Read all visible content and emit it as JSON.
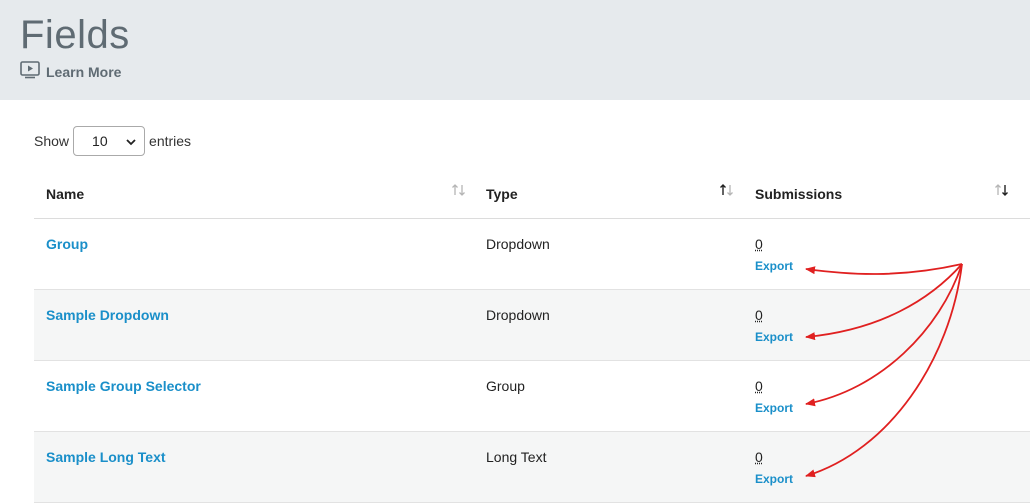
{
  "header": {
    "title": "Fields",
    "learn_more_label": "Learn More"
  },
  "controls": {
    "show_label": "Show",
    "page_size": "10",
    "entries_label": "entries"
  },
  "table": {
    "columns": [
      "Name",
      "Type",
      "Submissions"
    ],
    "rows": [
      {
        "name": "Group",
        "type": "Dropdown",
        "submissions": "0",
        "export_label": "Export"
      },
      {
        "name": "Sample Dropdown",
        "type": "Dropdown",
        "submissions": "0",
        "export_label": "Export"
      },
      {
        "name": "Sample Group Selector",
        "type": "Group",
        "submissions": "0",
        "export_label": "Export"
      },
      {
        "name": "Sample Long Text",
        "type": "Long Text",
        "submissions": "0",
        "export_label": "Export"
      }
    ]
  },
  "colors": {
    "link": "#1a8fc9",
    "header_bg": "#e6eaed",
    "annotation_arrow": "#e02020"
  }
}
